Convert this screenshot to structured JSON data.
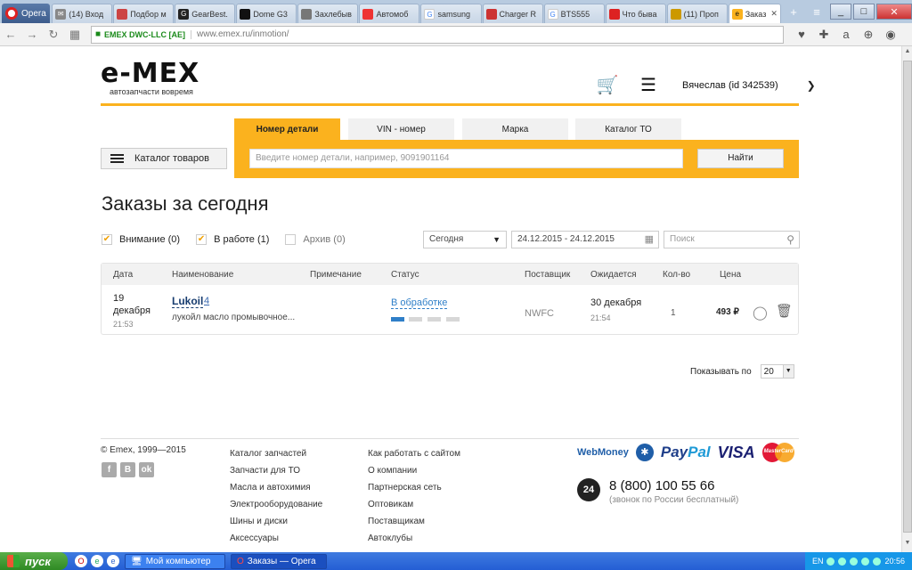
{
  "browser": {
    "menu_label": "Opera",
    "tabs": [
      {
        "label": "(14) Вход",
        "icon": "mail-icon"
      },
      {
        "label": "Подбор м",
        "icon": "fav-icon"
      },
      {
        "label": "GearBest.",
        "icon": "fav-icon"
      },
      {
        "label": "Dome G3",
        "icon": "fav-icon"
      },
      {
        "label": "Захлебыв",
        "icon": "fav-icon"
      },
      {
        "label": "Автомоб",
        "icon": "fav-icon"
      },
      {
        "label": "samsung",
        "icon": "google-icon"
      },
      {
        "label": "Charger R",
        "icon": "fav-icon"
      },
      {
        "label": "BTS555",
        "icon": "google-icon"
      },
      {
        "label": "Что быва",
        "icon": "fav-icon"
      },
      {
        "label": "(11) Проп",
        "icon": "fav-icon"
      },
      {
        "label": "Заказ",
        "icon": "emex-icon"
      }
    ],
    "site_badge": "EMEX DWC-LLC [AE]",
    "url": "www.emex.ru/inmotion/"
  },
  "header": {
    "logo_text": "e-MEX",
    "tagline": "автозапчасти вовремя",
    "user": "Вячеслав (id 342539)"
  },
  "search": {
    "tabs": [
      "Номер детали",
      "VIN - номер",
      "Марка",
      "Каталог ТО"
    ],
    "placeholder": "Введите номер детали, например, 9091901164",
    "button": "Найти",
    "catalog_button": "Каталог товаров"
  },
  "orders": {
    "title": "Заказы за сегодня",
    "filters": [
      {
        "label": "Внимание (0)",
        "checked": true
      },
      {
        "label": "В работе (1)",
        "checked": true
      },
      {
        "label": "Архив (0)",
        "checked": false
      }
    ],
    "period": "Сегодня",
    "date_range": "24.12.2015 - 24.12.2015",
    "search_placeholder": "Поиск",
    "columns": [
      "Дата",
      "Наименование",
      "Примечание",
      "Статус",
      "Поставщик",
      "Ожидается",
      "Кол-во",
      "Цена"
    ],
    "rows": [
      {
        "date_day": "19",
        "date_month": "декабря",
        "date_time": "21:53",
        "name": "Lukoil",
        "name_count": "4",
        "description": "лукойл масло промывочное...",
        "note": "",
        "status": "В обработке",
        "status_step": 1,
        "status_steps": 4,
        "supplier": "NWFC",
        "expected_date": "30 декабря",
        "expected_time": "21:54",
        "qty": "1",
        "price": "493 ₽"
      }
    ],
    "page_size_label": "Показывать по",
    "page_size": "20"
  },
  "footer": {
    "copyright": "© Emex, 1999—2015",
    "socials": [
      "f",
      "B",
      "ok"
    ],
    "col1": [
      "Каталог запчастей",
      "Запчасти для ТО",
      "Масла и автохимия",
      "Электрооборудование",
      "Шины и диски",
      "Аксессуары"
    ],
    "col2": [
      "Как работать с сайтом",
      "О компании",
      "Партнерская сеть",
      "Оптовикам",
      "Поставщикам",
      "Автоклубы"
    ],
    "payments": {
      "webmoney": "WebMoney",
      "paypal_a": "Pay",
      "paypal_b": "Pal",
      "visa": "VISA",
      "mastercard": "MasterCard"
    },
    "phone": "8 (800) 100 55 66",
    "phone_note": "(звонок по России бесплатный)"
  },
  "taskbar": {
    "start": "пуск",
    "tasks": [
      "Мой компьютер",
      "Заказы — Opera"
    ],
    "lang": "EN",
    "clock": "20:56"
  },
  "colors": {
    "accent": "#fbb21e",
    "link": "#173c6f",
    "status": "#2f7fc8"
  }
}
